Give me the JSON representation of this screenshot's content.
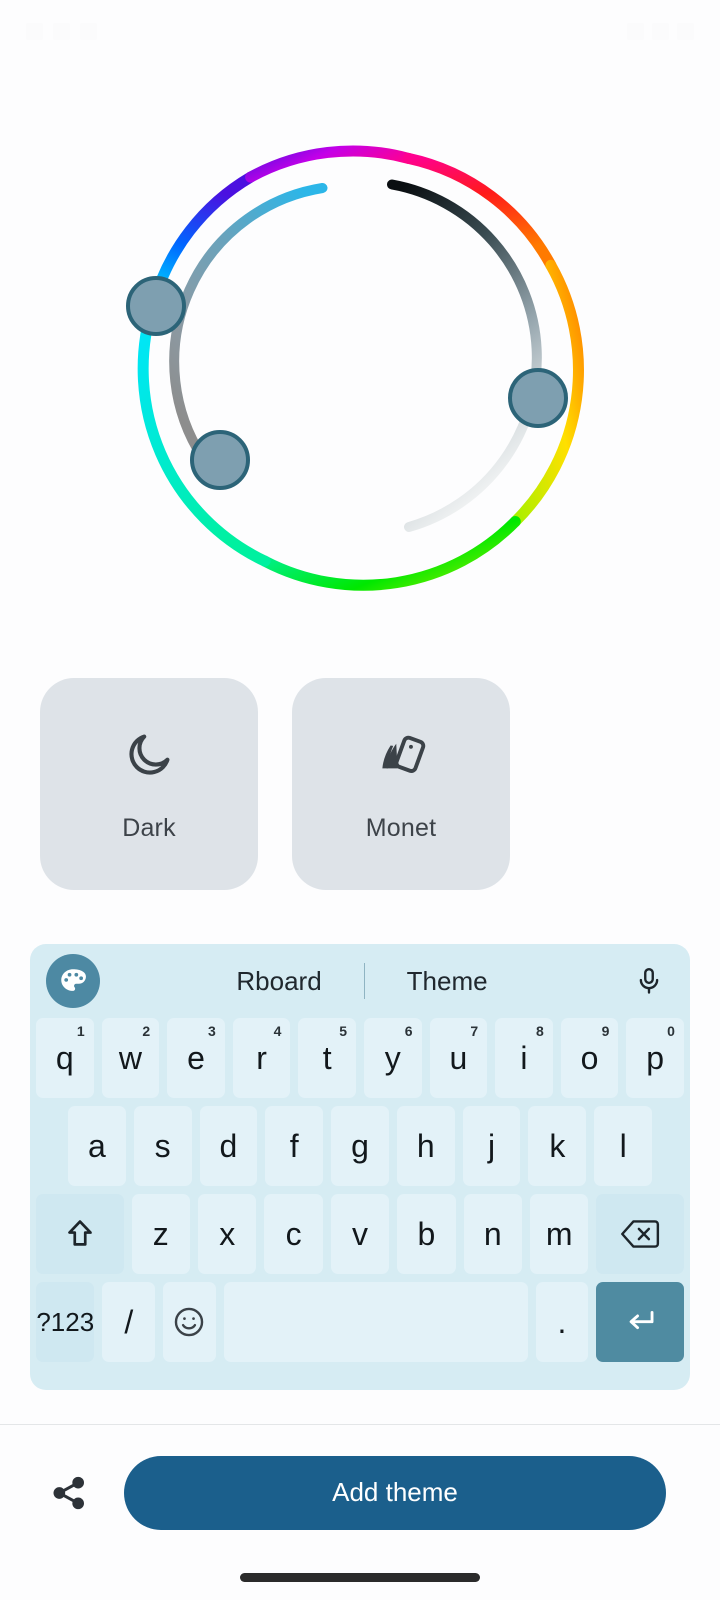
{
  "statusbar": {
    "time": "",
    "left_icons": [
      "notification-icon",
      "notification-icon",
      "notification-icon"
    ],
    "right_icons": [
      "wifi-icon",
      "signal-icon",
      "battery-icon"
    ]
  },
  "color_wheel": {
    "name": "hue-color-wheel",
    "outer_ring_label": "hue-ring",
    "handles": [
      {
        "id": "handle-left",
        "fill": "#7e9fb0",
        "stroke": "#2c6478"
      },
      {
        "id": "handle-bottom-left",
        "fill": "#7e9fb0",
        "stroke": "#2c6478"
      },
      {
        "id": "handle-right",
        "fill": "#7e9fb0",
        "stroke": "#2c6478"
      }
    ],
    "inner_arcs": [
      {
        "id": "arc-accent",
        "from": "#29b6e8",
        "to": "#8f8f8f"
      },
      {
        "id": "arc-neutral",
        "from": "#0b0f12",
        "to": "#f4f4f4"
      }
    ]
  },
  "theme_options": [
    {
      "label": "Dark",
      "icon": "moon-icon"
    },
    {
      "label": "Monet",
      "icon": "monet-phone-icon"
    }
  ],
  "keyboard": {
    "toolbar": {
      "palette_icon": "palette-icon",
      "app_name": "Rboard",
      "section": "Theme",
      "mic_icon": "microphone-icon"
    },
    "rows": {
      "row1": [
        {
          "key": "q",
          "sup": "1"
        },
        {
          "key": "w",
          "sup": "2"
        },
        {
          "key": "e",
          "sup": "3"
        },
        {
          "key": "r",
          "sup": "4"
        },
        {
          "key": "t",
          "sup": "5"
        },
        {
          "key": "y",
          "sup": "6"
        },
        {
          "key": "u",
          "sup": "7"
        },
        {
          "key": "i",
          "sup": "8"
        },
        {
          "key": "o",
          "sup": "9"
        },
        {
          "key": "p",
          "sup": "0"
        }
      ],
      "row2": [
        "a",
        "s",
        "d",
        "f",
        "g",
        "h",
        "j",
        "k",
        "l"
      ],
      "row3_shift_icon": "shift-icon",
      "row3": [
        "z",
        "x",
        "c",
        "v",
        "b",
        "n",
        "m"
      ],
      "row3_backspace_icon": "backspace-icon",
      "row4": {
        "symbols": "?123",
        "slash": "/",
        "emoji_icon": "emoji-icon",
        "space": "",
        "period": ".",
        "enter_icon": "enter-icon"
      }
    },
    "colors": {
      "background": "#d6ecf3",
      "key": "#e3f2f8",
      "modifier_key": "#cfe8f1",
      "enter_key": "#4f8ba1",
      "accent": "#4d89a3"
    }
  },
  "bottom_bar": {
    "share_icon": "share-icon",
    "primary_button": "Add theme",
    "primary_button_color": "#1b5f8c"
  }
}
